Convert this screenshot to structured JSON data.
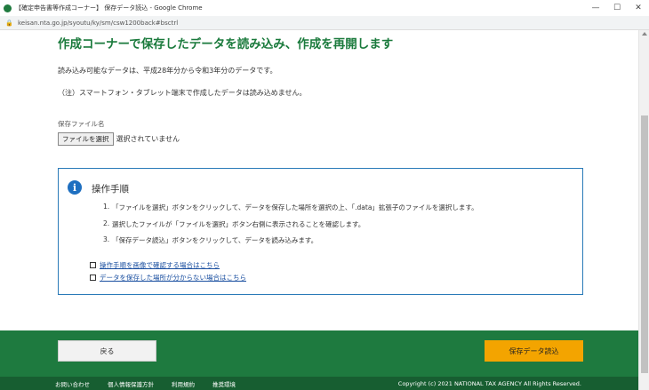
{
  "window": {
    "title": "【確定申告書等作成コーナー】 保存データ読込 - Google Chrome",
    "url": "keisan.nta.go.jp/syoutu/ky/sm/csw1200back#bsctrl",
    "controls": [
      "—",
      "☐",
      "✕"
    ]
  },
  "page": {
    "title": "作成コーナーで保存したデータを読み込み、作成を再開します",
    "intro": "読み込み可能なデータは、平成28年分から令和3年分のデータです。",
    "note": "（注）スマートフォン・タブレット端末で作成したデータは読み込めません。",
    "file_label": "保存ファイル名",
    "file_button": "ファイルを選択",
    "file_status": "選択されていません"
  },
  "howto": {
    "heading": "操作手順",
    "steps": [
      {
        "num": "1.",
        "text": "「ファイルを選択」ボタンをクリックして、データを保存した場所を選択の上、「.data」拡張子のファイルを選択します。"
      },
      {
        "num": "2.",
        "text": "選択したファイルが「ファイルを選択」ボタン右側に表示されることを確認します。"
      },
      {
        "num": "3.",
        "text": "「保存データ読込」ボタンをクリックして、データを読み込みます。"
      }
    ],
    "links": [
      "操作手順を画像で確認する場合はこちら",
      "データを保存した場所が分からない場合はこちら"
    ]
  },
  "actions": {
    "back_label": "戻る",
    "load_label": "保存データ読込"
  },
  "footer": {
    "links": [
      "お問い合わせ",
      "個人情報保護方針",
      "利用規約",
      "推奨環境"
    ],
    "copyright": "Copyright (c) 2021 NATIONAL TAX AGENCY All Rights Reserved."
  },
  "colors": {
    "title_green": "#1a7a3c",
    "footer_green": "#1e7a3f",
    "accent_orange": "#f3a400",
    "info_blue": "#1e6fc0"
  }
}
